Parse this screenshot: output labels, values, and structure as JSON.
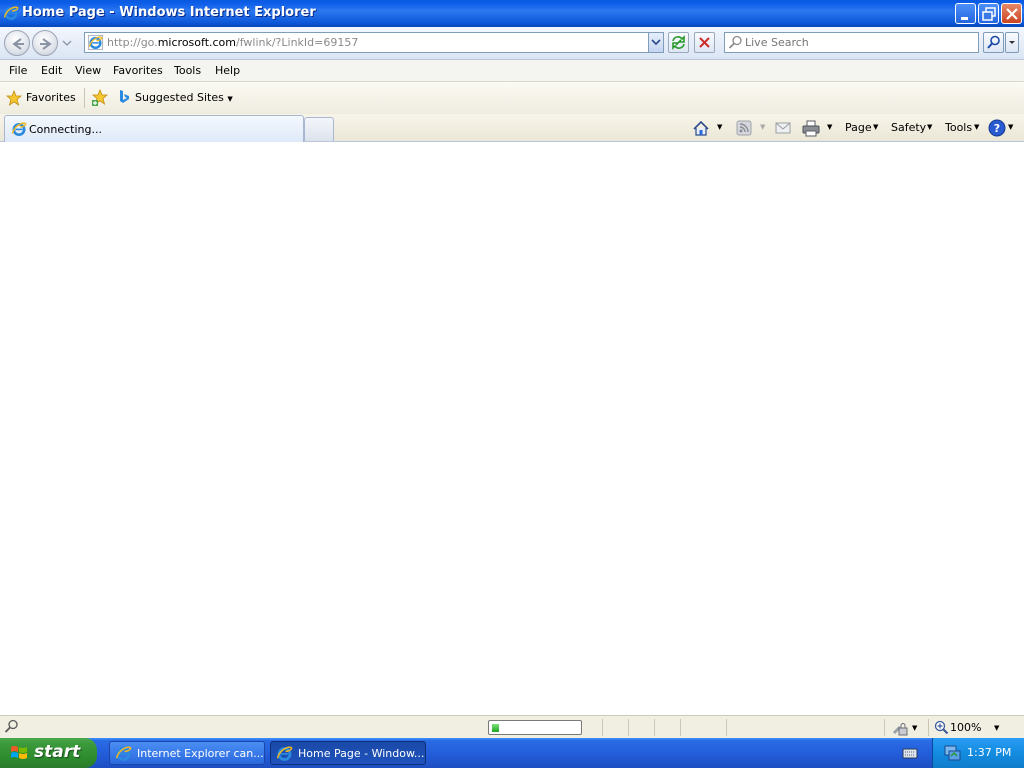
{
  "window": {
    "title": "Home Page - Windows Internet Explorer"
  },
  "address_bar": {
    "url_prefix": "http://go.",
    "url_host": "microsoft.com",
    "url_suffix": "/fwlink/?LinkId=69157"
  },
  "search": {
    "placeholder": "Live Search"
  },
  "menu": {
    "items": [
      "File",
      "Edit",
      "View",
      "Favorites",
      "Tools",
      "Help"
    ]
  },
  "favorites_bar": {
    "favorites_label": "Favorites",
    "suggested_sites_label": "Suggested Sites"
  },
  "tabs": [
    {
      "label": "Connecting..."
    }
  ],
  "command_bar": {
    "page_label": "Page",
    "safety_label": "Safety",
    "tools_label": "Tools"
  },
  "status_bar": {
    "zoom": "100%",
    "progress_fraction": 0.08
  },
  "taskbar": {
    "start_label": "start",
    "buttons": [
      {
        "label": "Internet Explorer can...",
        "active": false
      },
      {
        "label": "Home Page - Window...",
        "active": true
      }
    ],
    "clock": "1:37 PM"
  },
  "colors": {
    "titlebar_blue": "#0b5ce8",
    "taskbar_blue": "#245edb",
    "start_green": "#3c9a3c",
    "progress_green": "#1da51d"
  }
}
